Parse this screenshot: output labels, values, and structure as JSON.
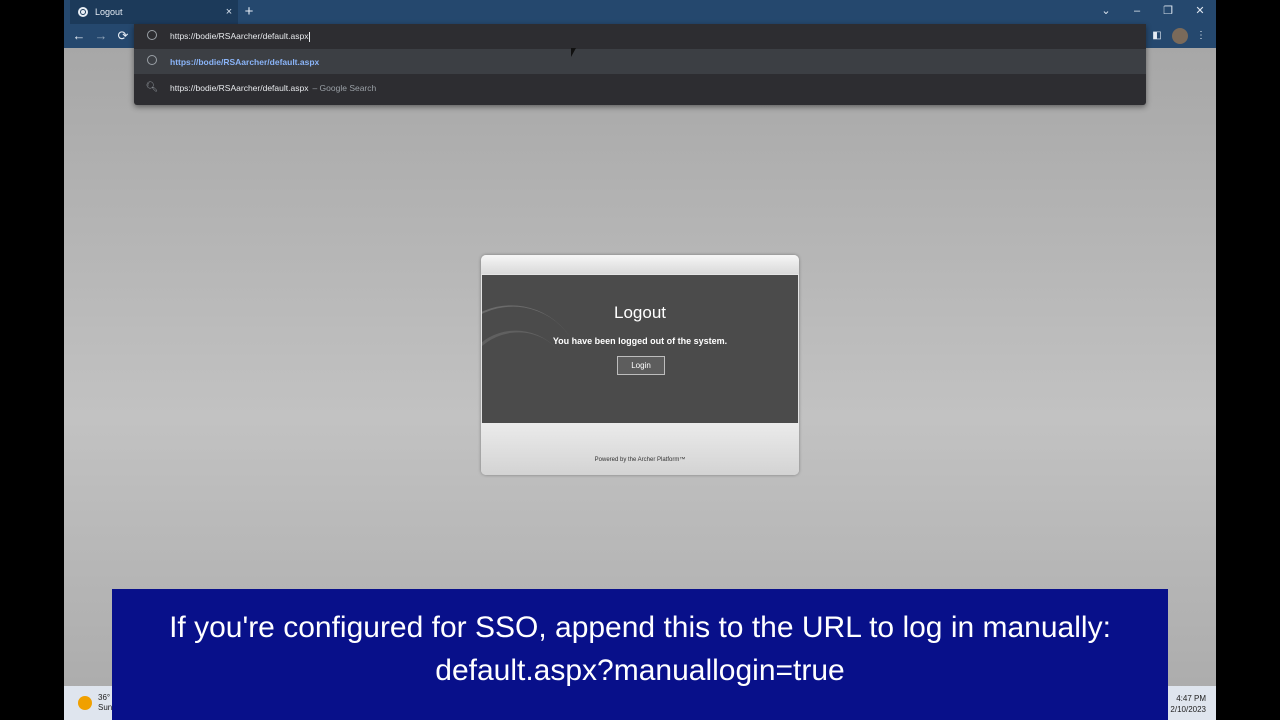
{
  "browser": {
    "tab_title": "Logout",
    "tab_close": "×",
    "new_tab": "+",
    "controls": {
      "dropdown": "⌄",
      "minimize": "–",
      "restore": "❐",
      "close": "✕"
    },
    "nav": {
      "back": "←",
      "forward": "→",
      "reload": "⟳"
    },
    "omnibox": {
      "input_text": "https://bodie/RSAarcher/default.aspx",
      "suggestions": [
        {
          "text": "https://bodie/RSAarcher/default.aspx",
          "suffix": ""
        },
        {
          "text": "https://bodie/RSAarcher/default.aspx",
          "suffix": "– Google Search"
        }
      ]
    },
    "side_icons": {
      "sidepanel": "◧",
      "menu": "⋮"
    }
  },
  "dialog": {
    "title": "Logout",
    "message": "You have been logged out of the system.",
    "login_label": "Login",
    "powered_by": "Powered by the Archer Platform™"
  },
  "taskbar": {
    "weather_temp": "36°",
    "weather_desc": "Sun",
    "time": "4:47 PM",
    "date": "2/10/2023"
  },
  "caption": {
    "line1": "If you're configured for SSO, append this to the URL to log in manually:",
    "line2": "default.aspx?manuallogin=true"
  }
}
